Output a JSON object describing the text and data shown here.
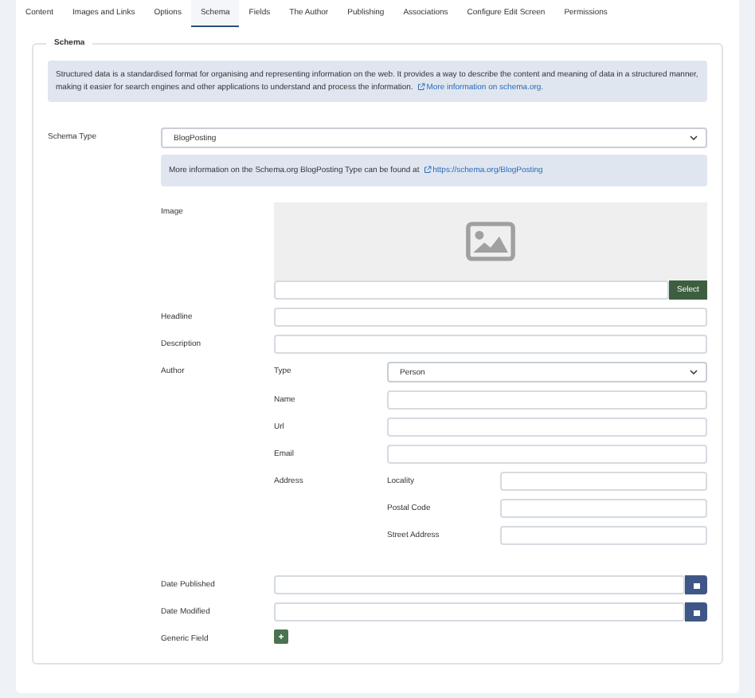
{
  "tabs": [
    {
      "label": "Content",
      "selected": false
    },
    {
      "label": "Images and Links",
      "selected": false
    },
    {
      "label": "Options",
      "selected": false
    },
    {
      "label": "Schema",
      "selected": true
    },
    {
      "label": "Fields",
      "selected": false
    },
    {
      "label": "The Author",
      "selected": false
    },
    {
      "label": "Publishing",
      "selected": false
    },
    {
      "label": "Associations",
      "selected": false
    },
    {
      "label": "Configure Edit Screen",
      "selected": false
    },
    {
      "label": "Permissions",
      "selected": false
    }
  ],
  "legend": "Schema",
  "info": {
    "text": "Structured data is a standardised format for organising and representing information on the web. It provides a way to describe the content and meaning of data in a structured manner, making it easier for search engines and other applications to understand and process the information.",
    "link": "More information on schema.org."
  },
  "schema_type": {
    "label": "Schema Type",
    "value": "BlogPosting"
  },
  "type_info": {
    "text": "More information on the Schema.org BlogPosting Type can be found at",
    "link": "https://schema.org/BlogPosting"
  },
  "fields": [
    {
      "kind": "image",
      "label": "Image",
      "button": "Select"
    },
    {
      "kind": "text",
      "label": "Headline"
    },
    {
      "kind": "text",
      "label": "Description"
    },
    {
      "kind": "group",
      "label": "Author",
      "children": [
        {
          "kind": "select",
          "label": "Type",
          "value": "Person"
        },
        {
          "kind": "text",
          "label": "Name"
        },
        {
          "kind": "text",
          "label": "Url"
        },
        {
          "kind": "text",
          "label": "Email"
        },
        {
          "kind": "group",
          "label": "Address",
          "children": [
            {
              "kind": "text",
              "label": "Locality"
            },
            {
              "kind": "text",
              "label": "Postal Code"
            },
            {
              "kind": "text",
              "label": "Street Address"
            }
          ]
        }
      ]
    },
    {
      "kind": "date",
      "label": "Date Published"
    },
    {
      "kind": "date",
      "label": "Date Modified"
    },
    {
      "kind": "add",
      "label": "Generic Field"
    }
  ]
}
